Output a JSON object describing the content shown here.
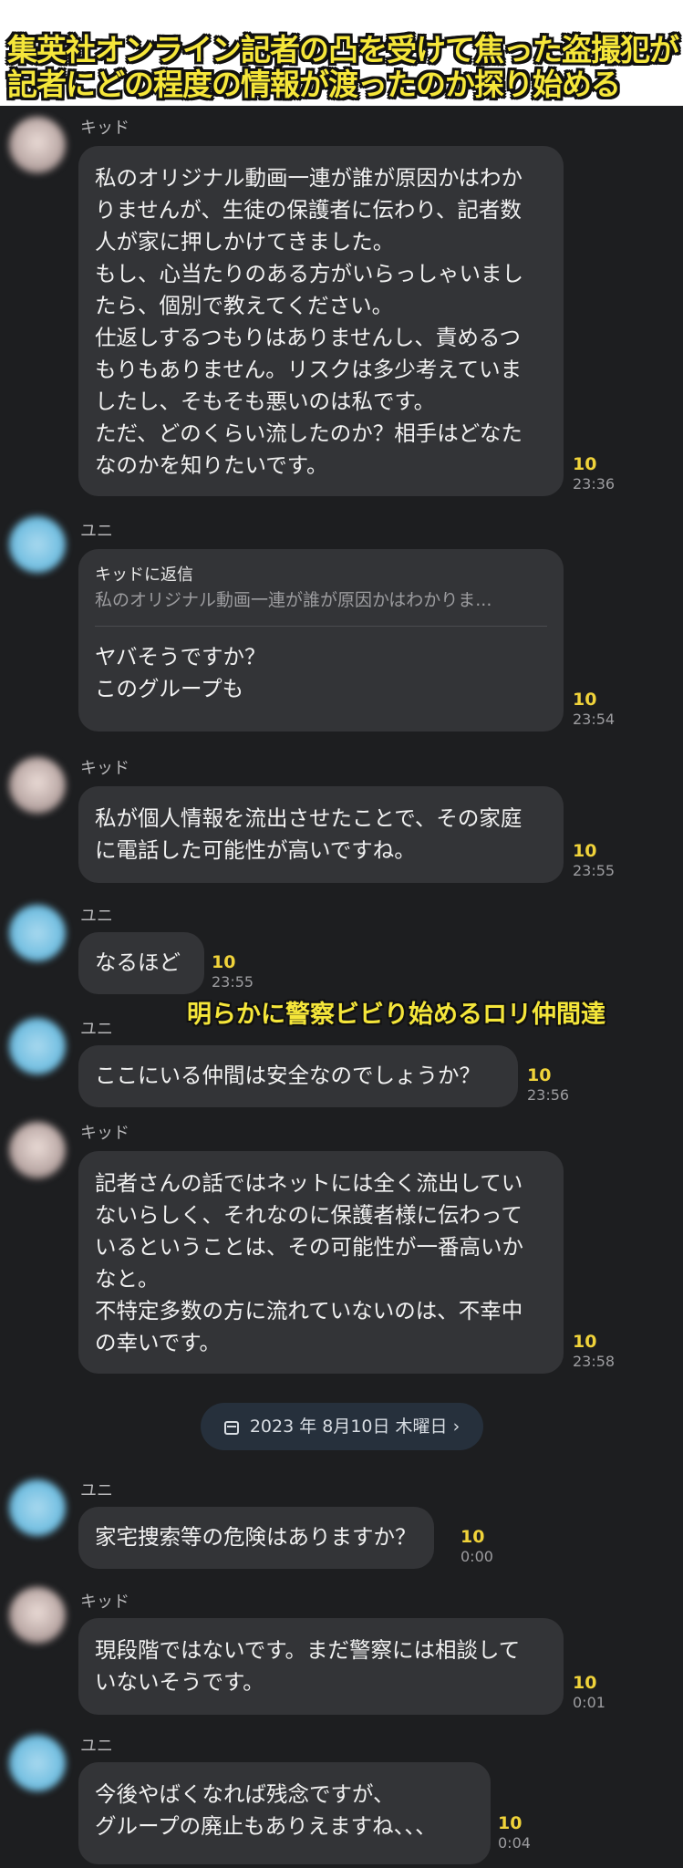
{
  "caption": {
    "line1": "集英社オンライン記者の凸を受けて焦った盗撮犯が",
    "line2": "記者にどの程度の情報が渡ったのか探り始める"
  },
  "overlay_caption": "明らかに警察ビビり始めるロリ仲間達",
  "date_divider": {
    "text": "2023 年 8月10日 木曜日",
    "chevron": "›",
    "icon": "calendar-icon"
  },
  "colors": {
    "background": "#1d1e20",
    "bubble": "#333437",
    "read_count": "#f0d33a",
    "caption_text": "#f5e63a",
    "caption_outline": "#111111"
  },
  "messages": [
    {
      "sender": "キッド",
      "lines": [
        "私のオリジナル動画一連が誰が原因かはわか",
        "りませんが、生徒の保護者に伝わり、記者数",
        "人が家に押しかけてきました。",
        "もし、心当たりのある方がいらっしゃいまし",
        "たら、個別で教えてください。",
        "仕返しするつもりはありませんし、責めるつ",
        "もりもありません。リスクは多少考えていま",
        "したし、そもそも悪いのは私です。",
        "ただ、どのくらい流したのか？相手はどなた",
        "なのかを知りたいです。"
      ],
      "read": "10",
      "time": "23:36"
    },
    {
      "sender": "ユニ",
      "reply_to": "キッドに返信",
      "reply_quote": "私のオリジナル動画一連が誰が原因かはわかりま...",
      "lines": [
        "ヤバそうですか？",
        "このグループも"
      ],
      "read": "10",
      "time": "23:54"
    },
    {
      "sender": "キッド",
      "lines": [
        "私が個人情報を流出させたことで、その家庭",
        "に電話した可能性が高いですね。"
      ],
      "read": "10",
      "time": "23:55"
    },
    {
      "sender": "ユニ",
      "lines": [
        "なるほど"
      ],
      "read": "10",
      "time": "23:55"
    },
    {
      "sender": "ユニ",
      "lines": [
        "ここにいる仲間は安全なのでしょうか？"
      ],
      "read": "10",
      "time": "23:56"
    },
    {
      "sender": "キッド",
      "lines": [
        "記者さんの話ではネットには全く流出してい",
        "ないらしく、それなのに保護者様に伝わって",
        "いるということは、その可能性が一番高いか",
        "なと。",
        "不特定多数の方に流れていないのは、不幸中",
        "の幸いです。"
      ],
      "read": "10",
      "time": "23:58"
    },
    {
      "sender": "ユニ",
      "lines": [
        "家宅捜索等の危険はありますか？"
      ],
      "read": "10",
      "time": "0:00"
    },
    {
      "sender": "キッド",
      "lines": [
        "現段階ではないです。まだ警察には相談して",
        "いないそうです。"
      ],
      "read": "10",
      "time": "0:01"
    },
    {
      "sender": "ユニ",
      "lines": [
        "今後やばくなれば残念ですが、",
        "グループの廃止もありえますね、、、"
      ],
      "read": "10",
      "time": "0:04"
    }
  ]
}
